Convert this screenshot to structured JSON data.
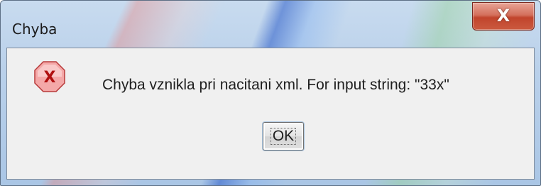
{
  "window": {
    "title": "Chyba",
    "close_label": "X"
  },
  "dialog": {
    "icon": "error-icon",
    "icon_glyph": "X",
    "message": "Chyba vznikla pri nacitani xml. For input string: \"33x\"",
    "ok_label": "OK"
  },
  "colors": {
    "close_button": "#c1442c",
    "error_icon_fill": "#f4a8a8",
    "error_icon_border": "#b83a3a",
    "error_icon_glyph": "#b01010",
    "client_background": "#f0f0f0"
  }
}
